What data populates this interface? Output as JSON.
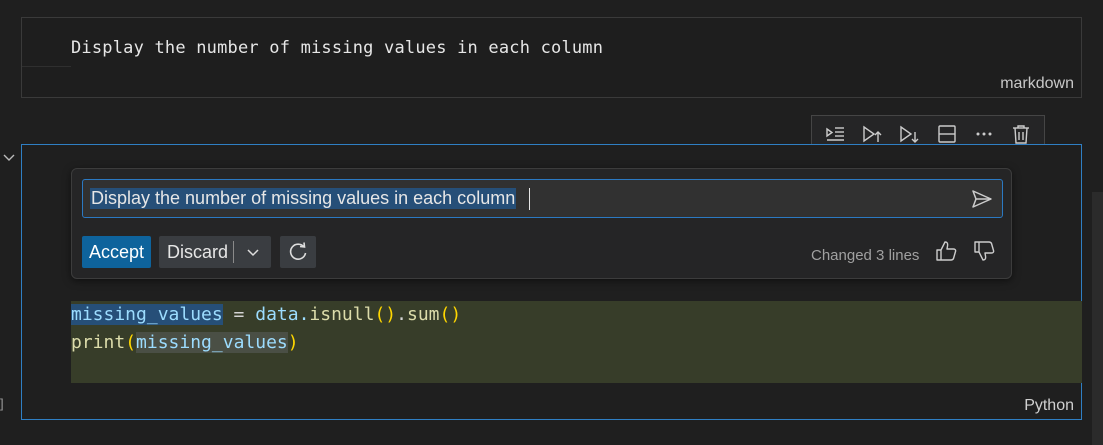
{
  "markdown_cell": {
    "text": "Display the number of missing values in each column",
    "language": "markdown"
  },
  "cell_toolbar": {
    "icons": [
      "run-by-line-icon",
      "execute-above-icon",
      "execute-below-icon",
      "split-cell-icon",
      "more-icon",
      "delete-icon"
    ]
  },
  "chat": {
    "prompt": "Display the number of missing values in each column",
    "accept_label": "Accept",
    "discard_label": "Discard",
    "changed_text": "Changed 3 lines"
  },
  "code": {
    "line1": {
      "var": "missing_values",
      "op": " = ",
      "obj": "data.",
      "fn1": "isnull",
      "p1": "()",
      "dot": ".",
      "fn2": "sum",
      "p2": "()"
    },
    "line2": {
      "fn": "print",
      "p_open": "(",
      "arg": "missing_values",
      "p_close": ")"
    }
  },
  "code_cell": {
    "language": "Python",
    "bracket": "]"
  },
  "colors": {
    "accent": "#0e639c",
    "cell_border": "#2f7fc4",
    "diff_bg": "#373d29"
  }
}
